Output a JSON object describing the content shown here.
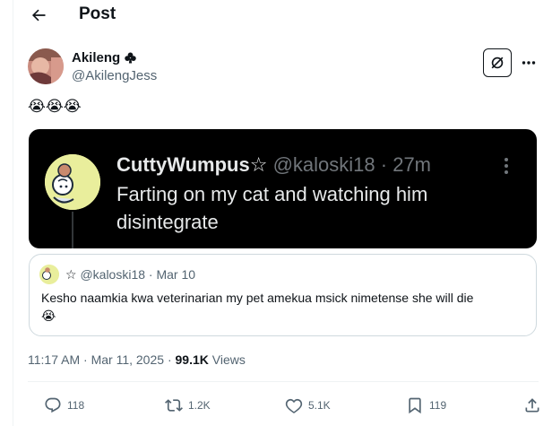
{
  "header": {
    "title": "Post",
    "back_icon": "arrow-left-icon"
  },
  "author": {
    "name": "Akileng",
    "name_badge_icon": "club-suit-icon",
    "handle": "@AkilengJess"
  },
  "tweet_text": "😭😭😭",
  "media": {
    "name": "CuttyWumpus",
    "name_symbol": "☆",
    "handle": "@kaloski18",
    "separator": "·",
    "time": "27m",
    "text": "Farting on my cat and watching him disintegrate"
  },
  "quote": {
    "symbol": "☆",
    "handle": "@kaloski18",
    "separator": "·",
    "date": "Mar 10",
    "text": "Kesho naamkia kwa veterinarian my pet amekua msick nimetense she will die",
    "emoji": "😭"
  },
  "meta": {
    "time": "11:17 AM",
    "separator": "·",
    "date": "Mar 11, 2025",
    "views_count": "99.1K",
    "views_label": "Views"
  },
  "actions": {
    "reply_count": "118",
    "retweet_count": "1.2K",
    "like_count": "5.1K",
    "bookmark_count": "119"
  },
  "colors": {
    "text_primary": "#0f1419",
    "text_secondary": "#536471",
    "border": "#cfd9de",
    "media_bg": "#000000"
  }
}
